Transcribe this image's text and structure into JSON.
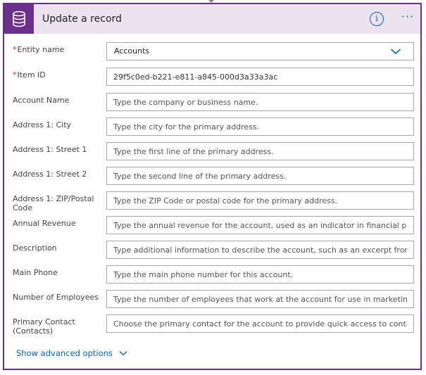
{
  "header": {
    "title": "Update a record",
    "info_glyph": "i",
    "more_glyph": "···",
    "accent_color": "#6b2f8c",
    "header_bg": "#ece3f1",
    "icon": "database-icon"
  },
  "fields": {
    "entity_name": {
      "label": "Entity name",
      "required": "*",
      "value": "Accounts"
    },
    "item_id": {
      "label": "Item ID",
      "required": "*",
      "value": "29f5c0ed-b221-e811-a845-000d3a33a3ac"
    },
    "account_name": {
      "label": "Account Name",
      "placeholder": "Type the company or business name."
    },
    "city": {
      "label": "Address 1: City",
      "placeholder": "Type the city for the primary address."
    },
    "street1": {
      "label": "Address 1: Street 1",
      "placeholder": "Type the first line of the primary address."
    },
    "street2": {
      "label": "Address 1: Street 2",
      "placeholder": "Type the second line of the primary address."
    },
    "zip": {
      "label": "Address 1: ZIP/Postal Code",
      "placeholder": "Type the ZIP Code or postal code for the primary address."
    },
    "annual_revenue": {
      "label": "Annual Revenue",
      "placeholder": "Type the annual revenue for the account, used as an indicator in financial perfo"
    },
    "description": {
      "label": "Description",
      "placeholder": "Type additional information to describe the account, such as an excerpt from th"
    },
    "main_phone": {
      "label": "Main Phone",
      "placeholder": "Type the main phone number for this account."
    },
    "num_employees": {
      "label": "Number of Employees",
      "placeholder": "Type the number of employees that work at the account for use in marketing s"
    },
    "primary_contact": {
      "label": "Primary Contact (Contacts)",
      "placeholder": "Choose the primary contact for the account to provide quick access to contact"
    }
  },
  "advanced": {
    "label": "Show advanced options"
  }
}
